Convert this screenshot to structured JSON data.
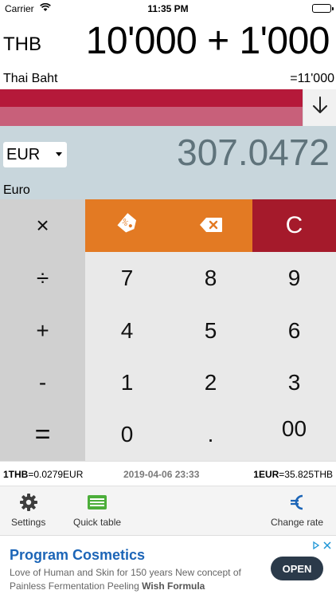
{
  "status_bar": {
    "carrier": "Carrier",
    "time": "11:35 PM"
  },
  "source": {
    "code": "THB",
    "name": "Thai Baht",
    "expression": "10'000 + 1'000",
    "result": "=11'000"
  },
  "target": {
    "code": "EUR",
    "name": "Euro",
    "value": "307.0472"
  },
  "keys": {
    "multiply": "×",
    "divide": "÷",
    "plus": "+",
    "minus": "-",
    "equals": "=",
    "clear": "C",
    "k7": "7",
    "k8": "8",
    "k9": "9",
    "k4": "4",
    "k5": "5",
    "k6": "6",
    "k1": "1",
    "k2": "2",
    "k3": "3",
    "k0": "0",
    "dot": ".",
    "k00": "00"
  },
  "colors": {
    "clear_key": "#a51a2b",
    "tag_key": "#e37a23",
    "delete_key": "#e37a23",
    "accent_blue": "#1c65b7"
  },
  "rates": {
    "left_code": "1THB",
    "left_value": "=0.0279EUR",
    "date": "2019-04-06 23:33",
    "right_code": "1EUR",
    "right_value": "=35.825THB"
  },
  "toolbar": {
    "settings": "Settings",
    "quick_table": "Quick table",
    "change_rate": "Change rate"
  },
  "ad": {
    "title": "Program Cosmetics",
    "text_plain": "Love of Human and Skin for 150 years New concept of Painless Fermentation Peeling ",
    "text_bold": "Wish Formula",
    "button": "OPEN"
  },
  "icons": [
    "wifi-icon",
    "battery-icon",
    "swap-arrow-icon",
    "percent-tag-icon",
    "backspace-icon",
    "gear-icon",
    "table-icon",
    "euro-icon",
    "ad-choices-icon"
  ]
}
